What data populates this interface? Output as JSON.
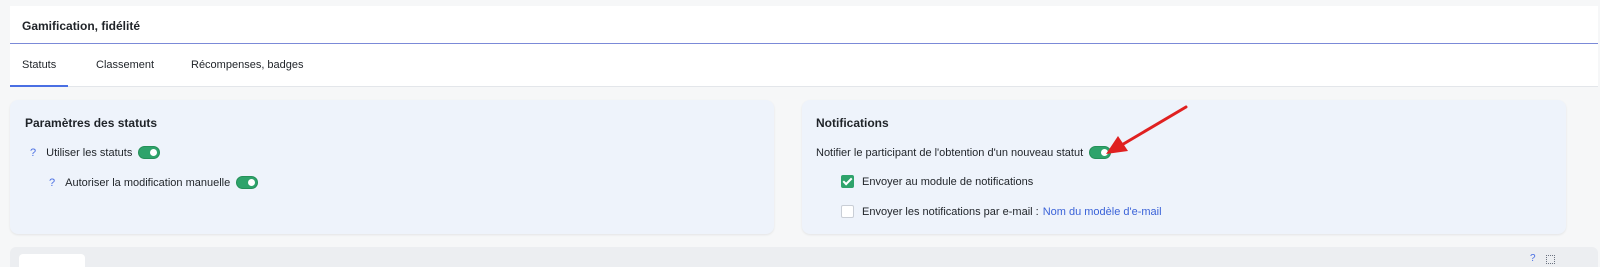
{
  "header": {
    "title": "Gamification, fidélité"
  },
  "tabs": [
    {
      "label": "Statuts",
      "active": true
    },
    {
      "label": "Classement",
      "active": false
    },
    {
      "label": "Récompenses, badges",
      "active": false
    }
  ],
  "status_params": {
    "title": "Paramètres des statuts",
    "use_statuses": {
      "help": "?",
      "label": "Utiliser les statuts",
      "enabled": true
    },
    "manual_edit": {
      "help": "?",
      "label": "Autoriser la modification manuelle",
      "enabled": true
    }
  },
  "notifications": {
    "title": "Notifications",
    "notify_new_status": {
      "label": "Notifier le participant de l'obtention d'un nouveau statut",
      "enabled": true
    },
    "send_to_module": {
      "label": "Envoyer au module de notifications",
      "checked": true
    },
    "send_email": {
      "label": "Envoyer les notifications par e-mail :",
      "link": "Nom du modèle d'e-mail",
      "checked": false
    }
  },
  "bottom": {
    "help": "?"
  },
  "colors": {
    "accent": "#4a6fe3",
    "toggle_on": "#2ea36b",
    "card_bg": "#eef3fb",
    "annotation_arrow": "#e02020"
  }
}
